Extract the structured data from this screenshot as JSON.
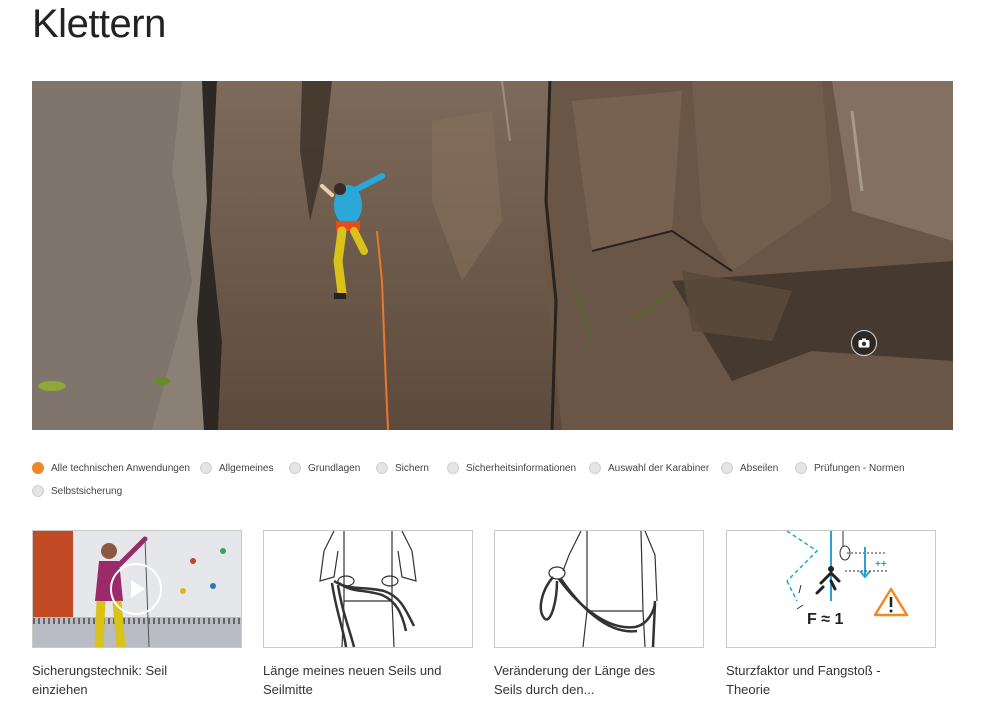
{
  "page": {
    "title": "Klettern"
  },
  "hero": {
    "icon": "camera-icon",
    "alt": ""
  },
  "filters": [
    {
      "label": "Alle technischen Anwendungen",
      "active": true
    },
    {
      "label": "Allgemeines",
      "active": false
    },
    {
      "label": "Grundlagen",
      "active": false
    },
    {
      "label": "Sichern",
      "active": false
    },
    {
      "label": "Sicherheitsinformationen",
      "active": false
    },
    {
      "label": "Auswahl der Karabiner",
      "active": false
    },
    {
      "label": "Abseilen",
      "active": false
    },
    {
      "label": "Prüfungen - Normen",
      "active": false
    },
    {
      "label": "Selbstsicherung",
      "active": false
    }
  ],
  "colors": {
    "accent": "#e9892a",
    "radio_inactive": "#e4e4e4",
    "warning": "#f08a24",
    "diagram_blue": "#27a3d8"
  },
  "cards": [
    {
      "title": "Sicherungstechnik: Seil einziehen",
      "type": "video",
      "icon": "play-icon"
    },
    {
      "title": "Länge meines neuen Seils und Seilmitte",
      "type": "illustration"
    },
    {
      "title": "Veränderung der Länge des Seils durch den...",
      "type": "illustration"
    },
    {
      "title": "Sturzfaktor und Fangstoß - Theorie",
      "type": "diagram",
      "formula_text": "F ≈ 1",
      "plus_text": "++"
    }
  ]
}
